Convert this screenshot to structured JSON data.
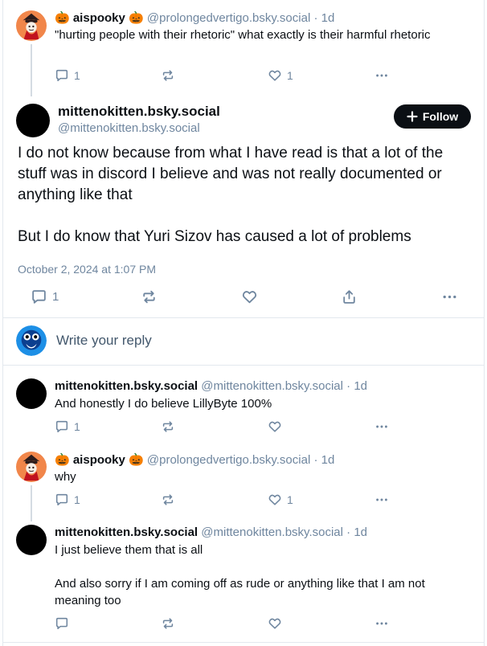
{
  "posts": {
    "p1": {
      "display_name": "🎃 aispooky 🎃",
      "handle": "@prolongedvertigo.bsky.social",
      "age": "1d",
      "text": "\"hurting people with their rhetoric\" what exactly is their harmful rhetoric",
      "reply_count": "1",
      "like_count": "1"
    },
    "main": {
      "display_name": "mittenokitten.bsky.social",
      "handle": "@mittenokitten.bsky.social",
      "follow_label": "Follow",
      "text_para1": "I do not know because from what I have read is that a lot of the stuff was in discord I believe and was not really documented or anything like that",
      "text_para2": "But I do know that Yuri Sizov has caused a lot of problems",
      "timestamp": "October 2, 2024 at 1:07 PM",
      "reply_count": "1"
    },
    "reply_box": {
      "placeholder": "Write your reply"
    },
    "r1": {
      "display_name": "mittenokitten.bsky.social",
      "handle": "@mittenokitten.bsky.social",
      "age": "1d",
      "text": "And honestly I do believe LillyByte 100%",
      "reply_count": "1"
    },
    "r2": {
      "display_name": "🎃 aispooky 🎃",
      "handle": "@prolongedvertigo.bsky.social",
      "age": "1d",
      "text": "why",
      "reply_count": "1",
      "like_count": "1"
    },
    "r3": {
      "display_name": "mittenokitten.bsky.social",
      "handle": "@mittenokitten.bsky.social",
      "age": "1d",
      "text_para1": "I just believe them that is all",
      "text_para2": "And also sorry if I am coming off as rude or anything like that I am not meaning too"
    }
  },
  "colors": {
    "muted": "#6f869f",
    "border": "#e3e8ee",
    "follow_bg": "#0b0f14"
  },
  "icons": [
    "reply-icon",
    "repost-icon",
    "like-icon",
    "more-icon",
    "share-icon",
    "plus-icon"
  ]
}
